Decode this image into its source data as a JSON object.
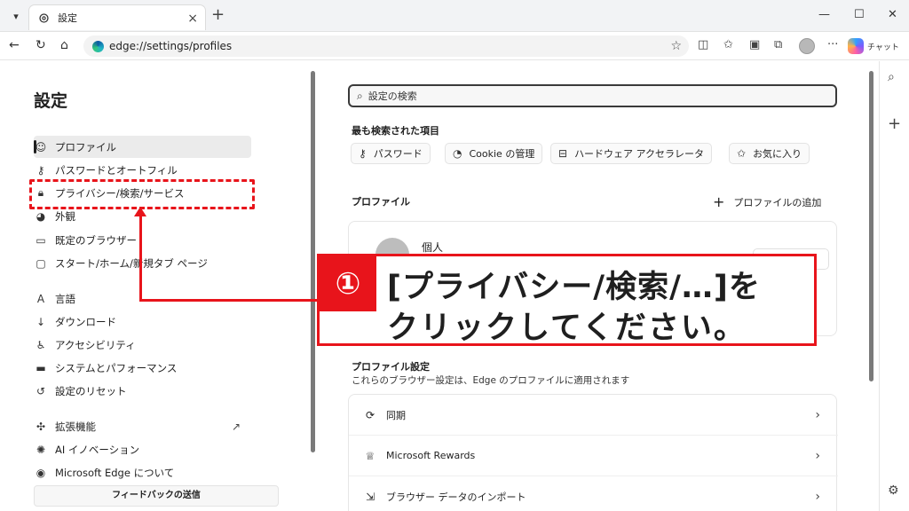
{
  "browser": {
    "tab_title": "設定",
    "address": "edge://settings/profiles",
    "chat_label": "チャット"
  },
  "sidebar": {
    "title": "設定",
    "items": [
      {
        "label": "プロファイル",
        "icon": "profile-icon",
        "active": true
      },
      {
        "label": "パスワードとオートフィル",
        "icon": "key-icon"
      },
      {
        "label": "プライバシー/検索/サービス",
        "icon": "lock-icon"
      },
      {
        "label": "外観",
        "icon": "palette-icon"
      },
      {
        "label": "既定のブラウザー",
        "icon": "browser-icon"
      },
      {
        "label": "スタート/ホーム/新規タブ ページ",
        "icon": "home-icon"
      },
      {
        "label": "言語",
        "icon": "language-icon"
      },
      {
        "label": "ダウンロード",
        "icon": "download-icon"
      },
      {
        "label": "アクセシビリティ",
        "icon": "accessibility-icon"
      },
      {
        "label": "システムとパフォーマンス",
        "icon": "laptop-icon"
      },
      {
        "label": "設定のリセット",
        "icon": "reset-icon"
      },
      {
        "label": "拡張機能",
        "icon": "puzzle-icon"
      },
      {
        "label": "AI イノベーション",
        "icon": "ai-icon"
      },
      {
        "label": "Microsoft Edge について",
        "icon": "edge-icon"
      }
    ],
    "feedback_label": "フィードバックの送信"
  },
  "main": {
    "search_placeholder": "設定の検索",
    "most_searched_title": "最も検索された項目",
    "chips": [
      "パスワード",
      "Cookie の管理",
      "ハードウェア アクセラレータ",
      "お気に入り"
    ],
    "profile_section_title": "プロファイル",
    "add_profile_label": "プロファイルの追加",
    "profile_name": "個人",
    "profile_settings_title": "プロファイル設定",
    "profile_settings_sub": "これらのブラウザー設定は、Edge のプロファイルに適用されます",
    "settings_rows": [
      "同期",
      "Microsoft Rewards",
      "ブラウザー データのインポート"
    ]
  },
  "callout": {
    "number": "①",
    "line1": "[プライバシー/検索/…]を",
    "line2": "クリックしてください。"
  },
  "colors": {
    "accent_red": "#e8141b"
  }
}
